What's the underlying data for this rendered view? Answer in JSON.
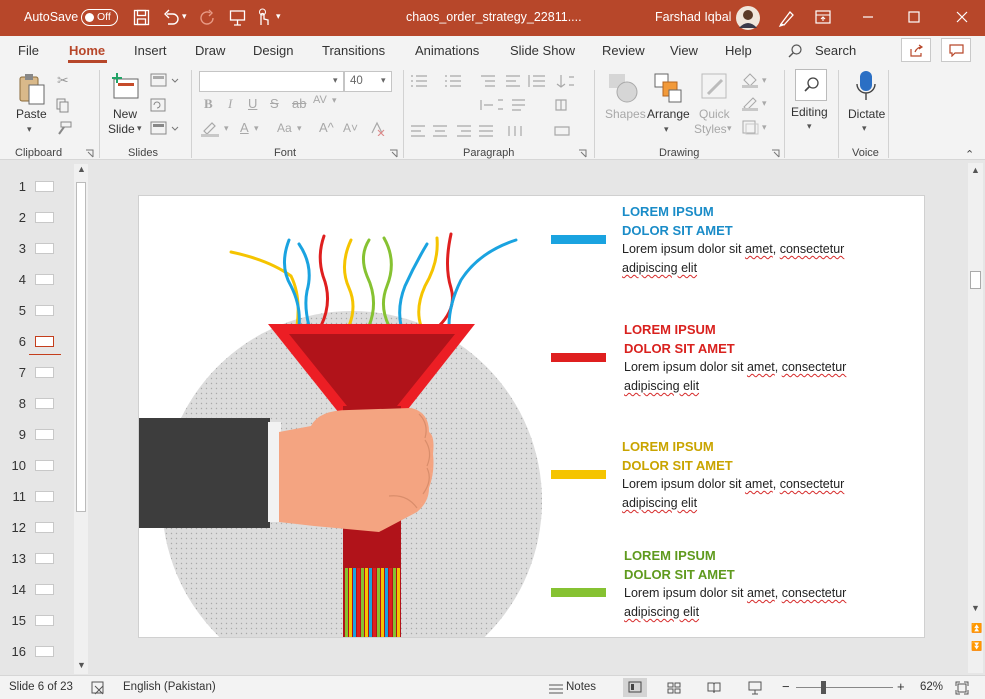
{
  "titlebar": {
    "autosave_label": "AutoSave",
    "autosave_state": "Off",
    "filename": "chaos_order_strategy_22811....",
    "user": "Farshad Iqbal"
  },
  "tabs": [
    "File",
    "Home",
    "Insert",
    "Draw",
    "Design",
    "Transitions",
    "Animations",
    "Slide Show",
    "Review",
    "View",
    "Help"
  ],
  "search_label": "Search",
  "ribbon": {
    "clipboard": {
      "paste": "Paste",
      "group": "Clipboard"
    },
    "slides": {
      "new_slide_1": "New",
      "new_slide_2": "Slide",
      "group": "Slides"
    },
    "font": {
      "name": "",
      "size": "40",
      "group": "Font"
    },
    "paragraph": {
      "group": "Paragraph"
    },
    "drawing": {
      "shapes": "Shapes",
      "arrange": "Arrange",
      "quick_1": "Quick",
      "quick_2": "Styles",
      "group": "Drawing"
    },
    "editing": {
      "label": "Editing"
    },
    "voice": {
      "dictate": "Dictate",
      "group": "Voice"
    }
  },
  "thumbnails": [
    "1",
    "2",
    "3",
    "4",
    "5",
    "6",
    "7",
    "8",
    "9",
    "10",
    "11",
    "12",
    "13",
    "14",
    "15",
    "16"
  ],
  "slide": {
    "items": [
      {
        "line1": "LOREM IPSUM",
        "line2": "DOLOR SIT AMET",
        "body_a": "Lorem ipsum dolor sit ",
        "amet": "amet",
        "body_b": ", ",
        "cons": "consectetur",
        "body2": "adipiscing elit",
        "color": "#1a8cc8",
        "bar": "#1aa3e0"
      },
      {
        "line1": "LOREM IPSUM",
        "line2": "DOLOR SIT AMET",
        "body_a": "Lorem ipsum dolor sit ",
        "amet": "amet",
        "body_b": ", ",
        "cons": "consectetur",
        "body2": "adipiscing elit",
        "color": "#d9211e",
        "bar": "#df1f1f"
      },
      {
        "line1": "LOREM IPSUM",
        "line2": "DOLOR SIT AMET",
        "body_a": "Lorem ipsum dolor sit ",
        "amet": "amet",
        "body_b": ", ",
        "cons": "consectetur",
        "body2": "adipiscing elit",
        "color": "#c9a400",
        "bar": "#f5c400"
      },
      {
        "line1": "LOREM IPSUM",
        "line2": "DOLOR SIT AMET",
        "body_a": "Lorem ipsum dolor sit ",
        "amet": "amet",
        "body_b": ", ",
        "cons": "consectetur",
        "body2": "adipiscing elit",
        "color": "#5f9a1e",
        "bar": "#86c232"
      }
    ]
  },
  "status": {
    "slide_info": "Slide 6 of 23",
    "language": "English (Pakistan)",
    "notes": "Notes",
    "zoom": "62%"
  }
}
